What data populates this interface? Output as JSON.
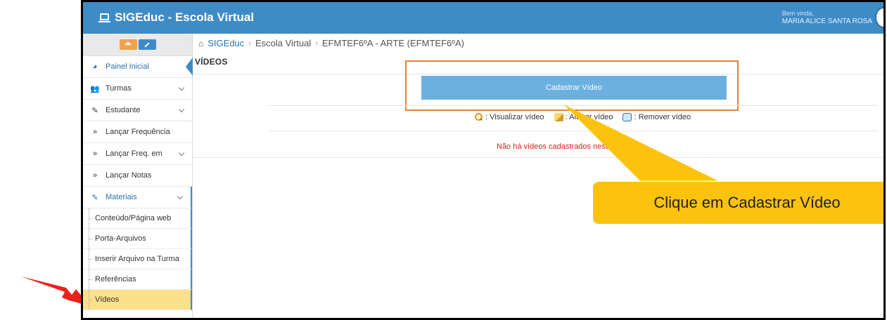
{
  "app": {
    "title": "SIGEduc - Escola Virtual"
  },
  "header": {
    "welcome_label": "Bem vinda,",
    "user_name": "MARIA ALICE SANTA ROSA"
  },
  "sidebar": {
    "items": [
      {
        "label": "Painel Inicial",
        "icon": "dashboard-icon"
      },
      {
        "label": "Turmas",
        "icon": "users-icon"
      },
      {
        "label": "Estudante",
        "icon": "edit-icon"
      },
      {
        "label": "Lançar Frequência",
        "icon": "double-chevron-icon"
      },
      {
        "label": "Lançar Freq. em",
        "icon": "double-chevron-icon"
      },
      {
        "label": "Lançar Notas",
        "icon": "double-chevron-icon"
      },
      {
        "label": "Materiais",
        "icon": "edit-icon"
      }
    ],
    "subitems": [
      {
        "label": "Conteúdo/Página web"
      },
      {
        "label": "Porta-Arquivos"
      },
      {
        "label": "Inserir Arquivo na Turma"
      },
      {
        "label": "Referências"
      },
      {
        "label": "Vídeos"
      }
    ]
  },
  "breadcrumb": {
    "home": "SIGEduc",
    "level1": "Escola Virtual",
    "level2": "EFMTEF6ºA - ARTE (EFMTEF6ºA)"
  },
  "main": {
    "page_title": "VÍDEOS",
    "register_button": "Cadastrar Vídeo",
    "legend": {
      "view": ": Visualizar vídeo",
      "edit": ": Alterar vídeo",
      "remove": ": Remover vídeo"
    },
    "empty_message": "Não há vídeos cadastrados nesta turma."
  },
  "callout": {
    "text": "Clique em Cadastrar Vídeo"
  },
  "colors": {
    "topbar": "#3f8bc6",
    "button": "#6cb0e0",
    "highlight_box": "#e2823a",
    "callout": "#fbc210",
    "selected_item": "#fde08a",
    "error_text": "#e41b1b",
    "annotation_arrow": "#e8231c"
  }
}
